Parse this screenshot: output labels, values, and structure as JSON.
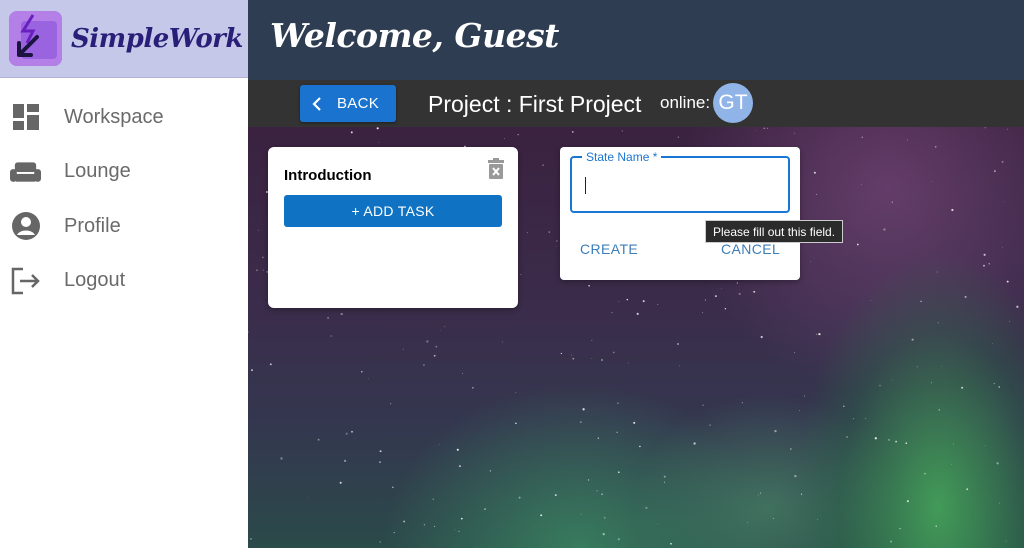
{
  "brand": {
    "name": "SimpleWork",
    "logo_icon": "bolt-arrow-logo"
  },
  "nav": [
    {
      "label": "Workspace",
      "icon": "dashboard-icon"
    },
    {
      "label": "Lounge",
      "icon": "sofa-icon"
    },
    {
      "label": "Profile",
      "icon": "account-circle-icon"
    },
    {
      "label": "Logout",
      "icon": "logout-icon"
    }
  ],
  "header": {
    "welcome": "Welcome, Guest"
  },
  "subbar": {
    "back_label": "BACK",
    "project_title": "Project : First Project",
    "online_label": "online:",
    "avatar_initials": "GT"
  },
  "intro_card": {
    "title": "Introduction",
    "add_task_label": "+ ADD TASK"
  },
  "state_form": {
    "field_label": "State Name *",
    "field_value": "",
    "create_label": "CREATE",
    "cancel_label": "CANCEL",
    "validation_tooltip": "Please fill out this field."
  },
  "colors": {
    "sidebar_brand_bg": "#c5c8e9",
    "header_bg": "#2e3d52",
    "subbar_bg": "#333333",
    "primary_button": "#1a73cf",
    "field_focus": "#1976d2"
  }
}
